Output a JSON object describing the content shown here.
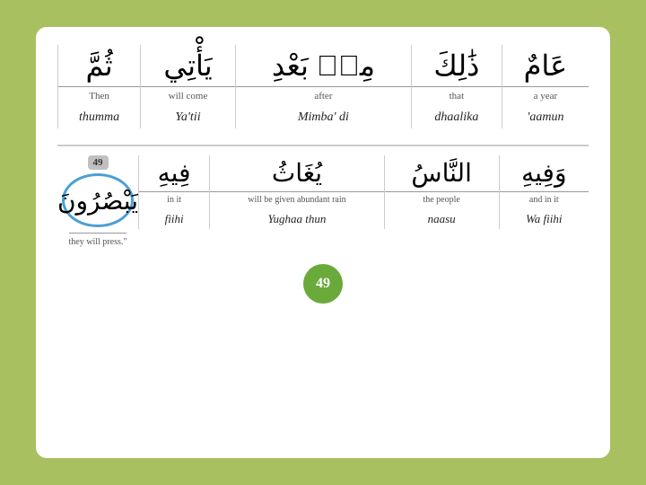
{
  "top": {
    "columns": [
      {
        "arabic": "ثُمَّ",
        "label": "Then",
        "transliteration": "thumma"
      },
      {
        "arabic": "يَأْتِي",
        "label": "will come",
        "transliteration": "Ya'tii"
      },
      {
        "arabic": "مِنۢ بَعْدِ",
        "label": "after",
        "transliteration": "Mimba' di"
      },
      {
        "arabic": "ذَٰلِكَ",
        "label": "that",
        "transliteration": "dhaalika"
      },
      {
        "arabic": "عَامٌ",
        "label": "a year",
        "transliteration": "'aamun"
      }
    ]
  },
  "bottom": {
    "left": {
      "number": "49",
      "arabic_circle": "يَبْصُرُونَ",
      "sublabel": "they will press.\""
    },
    "columns": [
      {
        "arabic": "فِيهِ",
        "label": "in it",
        "transliteration": "fiihi"
      },
      {
        "arabic": "يُغَاثُ",
        "label": "will be given abundant rain",
        "transliteration": "Yughaa thun"
      },
      {
        "arabic": "النَّاسُ",
        "label": "the people",
        "transliteration": "naasu"
      },
      {
        "arabic": "وَفِيهِ",
        "label": "and in it",
        "transliteration": "Wa fiihi"
      }
    ]
  },
  "page_number": "49"
}
